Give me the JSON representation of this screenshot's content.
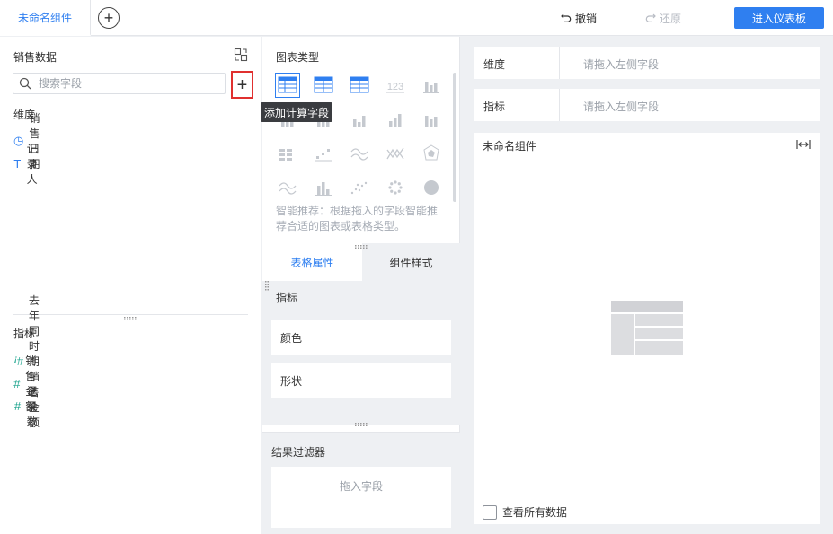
{
  "topbar": {
    "tab_name": "未命名组件",
    "add_tab_symbol": "+",
    "undo_label": "撤销",
    "redo_label": "还原",
    "enter_dashboard_label": "进入仪表板",
    "accent_color": "#2f7ff0"
  },
  "left": {
    "dataset_title": "销售数据",
    "search_placeholder": "搜索字段",
    "add_calc_symbol": "+",
    "add_calc_tooltip": "添加计算字段",
    "dimension_label": "维度",
    "dimensions": [
      {
        "label": "销售日期",
        "icon": "clock-icon",
        "icon_glyph": "◷"
      },
      {
        "label": "记录人",
        "icon": "text-type-icon",
        "icon_glyph": "T"
      }
    ],
    "metric_label": "指标",
    "metrics": [
      {
        "label": "去年同时期销售金额",
        "icon": "calc-number-icon",
        "icon_glyph": "ꜟ#"
      },
      {
        "label": "销售金额",
        "icon": "number-icon",
        "icon_glyph": "#"
      },
      {
        "label": "记录数",
        "icon": "count-number-icon",
        "icon_glyph": "#"
      }
    ],
    "field_icon_color": "#1aa38c"
  },
  "middle": {
    "chart_type_title": "图表类型",
    "chart_types": [
      {
        "icon": "grouped-table-icon",
        "selected": true
      },
      {
        "icon": "detail-table-icon",
        "selected": false
      },
      {
        "icon": "cross-table-icon",
        "selected": false
      },
      {
        "icon": "kpi-number-icon",
        "selected": false,
        "text": "123"
      },
      {
        "icon": "form-table-icon",
        "selected": false
      },
      {
        "icon": "bar-table-icon",
        "selected": false
      },
      {
        "icon": "grid-bar-icon",
        "selected": false
      },
      {
        "icon": "stacked-bar-icon",
        "selected": false
      },
      {
        "icon": "grouped-bar-icon",
        "selected": false
      },
      {
        "icon": "column-chart-icon",
        "selected": false
      },
      {
        "icon": "matrix-icon",
        "selected": false
      },
      {
        "icon": "step-scatter-icon",
        "selected": false
      },
      {
        "icon": "wave-line-icon",
        "selected": false
      },
      {
        "icon": "cross-line-icon",
        "selected": false
      },
      {
        "icon": "radar-icon",
        "selected": false
      },
      {
        "icon": "area-chart-icon",
        "selected": false
      },
      {
        "icon": "histogram-icon",
        "selected": false
      },
      {
        "icon": "scatter-icon",
        "selected": false
      },
      {
        "icon": "bubble-icon",
        "selected": false
      },
      {
        "icon": "pie-chart-icon",
        "selected": false
      }
    ],
    "smart_hint": "智能推荐：根据拖入的字段智能推荐合适的图表或表格类型。",
    "tabs": [
      "表格属性",
      "组件样式"
    ],
    "metric_title": "指标",
    "props": [
      "颜色",
      "形状"
    ],
    "filter_title": "结果过滤器",
    "filter_drop_hint": "拖入字段"
  },
  "right": {
    "dimension_label": "维度",
    "dimension_hint": "请拖入左侧字段",
    "metric_label": "指标",
    "metric_hint": "请拖入左侧字段",
    "widget_title": "未命名组件",
    "view_all_label": "查看所有数据"
  }
}
